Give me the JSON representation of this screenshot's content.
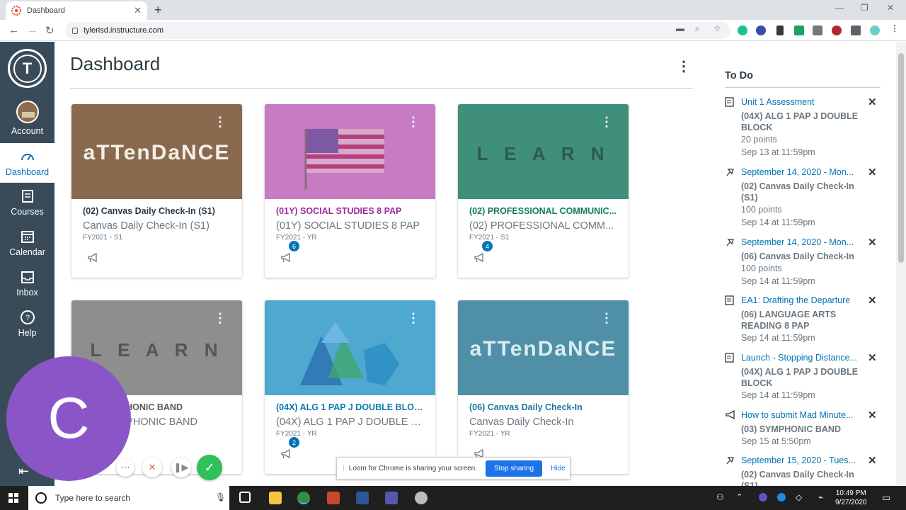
{
  "browser": {
    "tab_title": "Dashboard",
    "tab_close": "✕",
    "new_tab": "+",
    "url": "tylerisd.instructure.com"
  },
  "global_nav": {
    "account": "Account",
    "dashboard": "Dashboard",
    "courses": "Courses",
    "calendar": "Calendar",
    "inbox": "Inbox",
    "help": "Help"
  },
  "dashboard": {
    "title": "Dashboard",
    "cards": [
      {
        "title": "(02) Canvas Daily Check-In (S1)",
        "subtitle": "Canvas Daily Check-In (S1)",
        "term": "FY2021 - S1",
        "badge": "",
        "title_color": "#2d3b45",
        "hero_text": "aTTenDaNCE"
      },
      {
        "title": "(01Y) SOCIAL STUDIES 8 PAP",
        "subtitle": "(01Y) SOCIAL STUDIES 8 PAP",
        "term": "FY2021 - YR",
        "badge": "6",
        "title_color": "#9e2a9e",
        "hero_text": ""
      },
      {
        "title": "(02) PROFESSIONAL COMMUNIC...",
        "subtitle": "(02) PROFESSIONAL COMM...",
        "term": "FY2021 - S1",
        "badge": "4",
        "title_color": "#127a5e",
        "hero_text": "L E A R N"
      },
      {
        "title": "(03) SYMPHONIC BAND",
        "subtitle": "(03) SYMPHONIC BAND",
        "term": "FY2021 - YR",
        "badge": "",
        "title_color": "#5a5a5a",
        "hero_text": "L E A R N"
      },
      {
        "title": "(04X) ALG 1 PAP J DOUBLE BLOCK",
        "subtitle": "(04X) ALG 1 PAP J DOUBLE B...",
        "term": "FY2021 - YR",
        "badge": "2",
        "title_color": "#0a7cae",
        "hero_text": ""
      },
      {
        "title": "(06) Canvas Daily Check-In",
        "subtitle": "Canvas Daily Check-In",
        "term": "FY2021 - YR",
        "badge": "",
        "title_color": "#127a9e",
        "hero_text": "aTTenDaNCE"
      }
    ]
  },
  "todo": {
    "title": "To Do",
    "items": [
      {
        "link": "Unit 1 Assessment",
        "course": "(04X) ALG 1 PAP J DOUBLE BLOCK",
        "points": "20 points",
        "due": "Sep 13 at 11:59pm",
        "icon": "assignment-icon"
      },
      {
        "link": "September 14, 2020 - Mon...",
        "course": "(02) Canvas Daily Check-In (S1)",
        "points": "100 points",
        "due": "Sep 14 at 11:59pm",
        "icon": "quiz-icon"
      },
      {
        "link": "September 14, 2020 - Mon...",
        "course": "(06) Canvas Daily Check-In",
        "points": "100 points",
        "due": "Sep 14 at 11:59pm",
        "icon": "quiz-icon"
      },
      {
        "link": "EA1: Drafting the Departure",
        "course": "(06) LANGUAGE ARTS READING 8 PAP",
        "points": "",
        "due": "Sep 14 at 11:59pm",
        "icon": "assignment-icon"
      },
      {
        "link": "Launch - Stopping Distance...",
        "course": "(04X) ALG 1 PAP J DOUBLE BLOCK",
        "points": "",
        "due": "Sep 14 at 11:59pm",
        "icon": "assignment-icon"
      },
      {
        "link": "How to submit Mad Minute...",
        "course": "(03) SYMPHONIC BAND",
        "points": "",
        "due": "Sep 15 at 5:50pm",
        "icon": "announcement-icon"
      },
      {
        "link": "September 15, 2020 - Tues...",
        "course": "(02) Canvas Daily Check-In (S1)",
        "points": "",
        "due": "",
        "icon": "quiz-icon"
      }
    ]
  },
  "loom": {
    "bubble_letter": "C",
    "share_text": "Loom for Chrome is sharing your screen.",
    "stop": "Stop sharing",
    "hide": "Hide"
  },
  "taskbar": {
    "search_placeholder": "Type here to search",
    "time": "10:49 PM",
    "date": "9/27/2020"
  }
}
